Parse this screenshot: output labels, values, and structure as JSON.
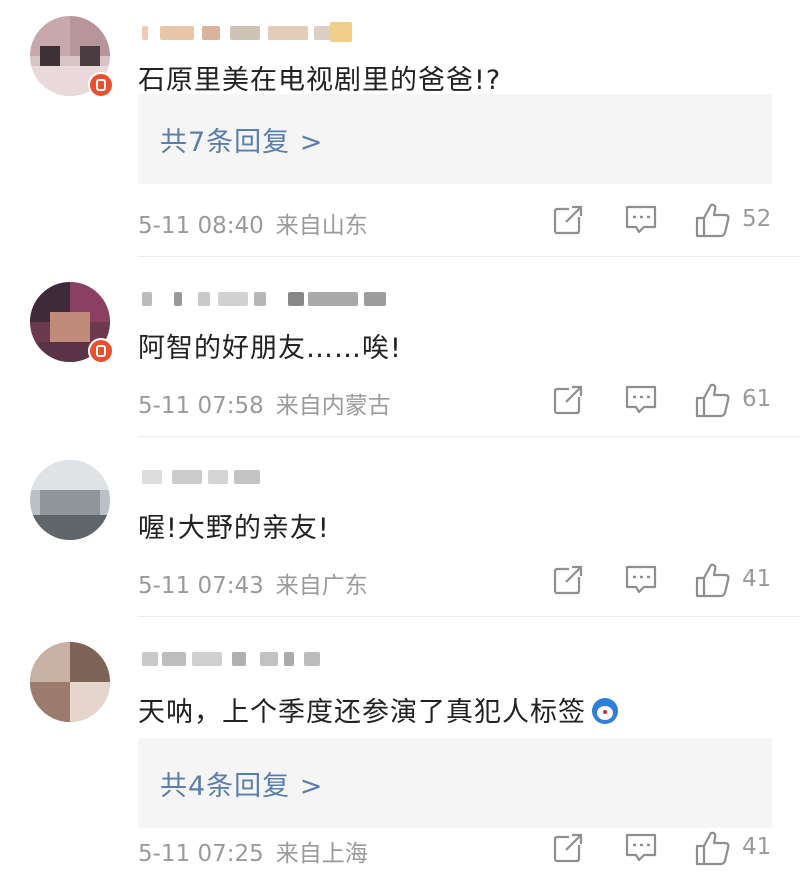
{
  "comments": [
    {
      "text": "石原里美在电视剧里的爸爸!?",
      "replies_label": "共7条回复 >",
      "time": "5-11 08:40",
      "location": "来自山东",
      "likes": "52"
    },
    {
      "text": "阿智的好朋友……唉!",
      "time": "5-11 07:58",
      "location": "来自内蒙古",
      "likes": "61"
    },
    {
      "text": "喔!大野的亲友!",
      "time": "5-11 07:43",
      "location": "来自广东",
      "likes": "41"
    },
    {
      "text": "天呐，上个季度还参演了真犯人标签",
      "emoji": "doraemon-emoji",
      "replies_label": "共4条回复 >",
      "time": "5-11 07:25",
      "location": "来自上海",
      "likes": "41"
    }
  ],
  "icons": {
    "share": "share-icon",
    "comment": "comment-icon",
    "like": "thumbs-up-icon"
  },
  "colors": {
    "link": "#5a7ea8",
    "meta": "#9a9a9a",
    "reply_bg": "#f5f5f6",
    "badge": "#e8502f"
  }
}
